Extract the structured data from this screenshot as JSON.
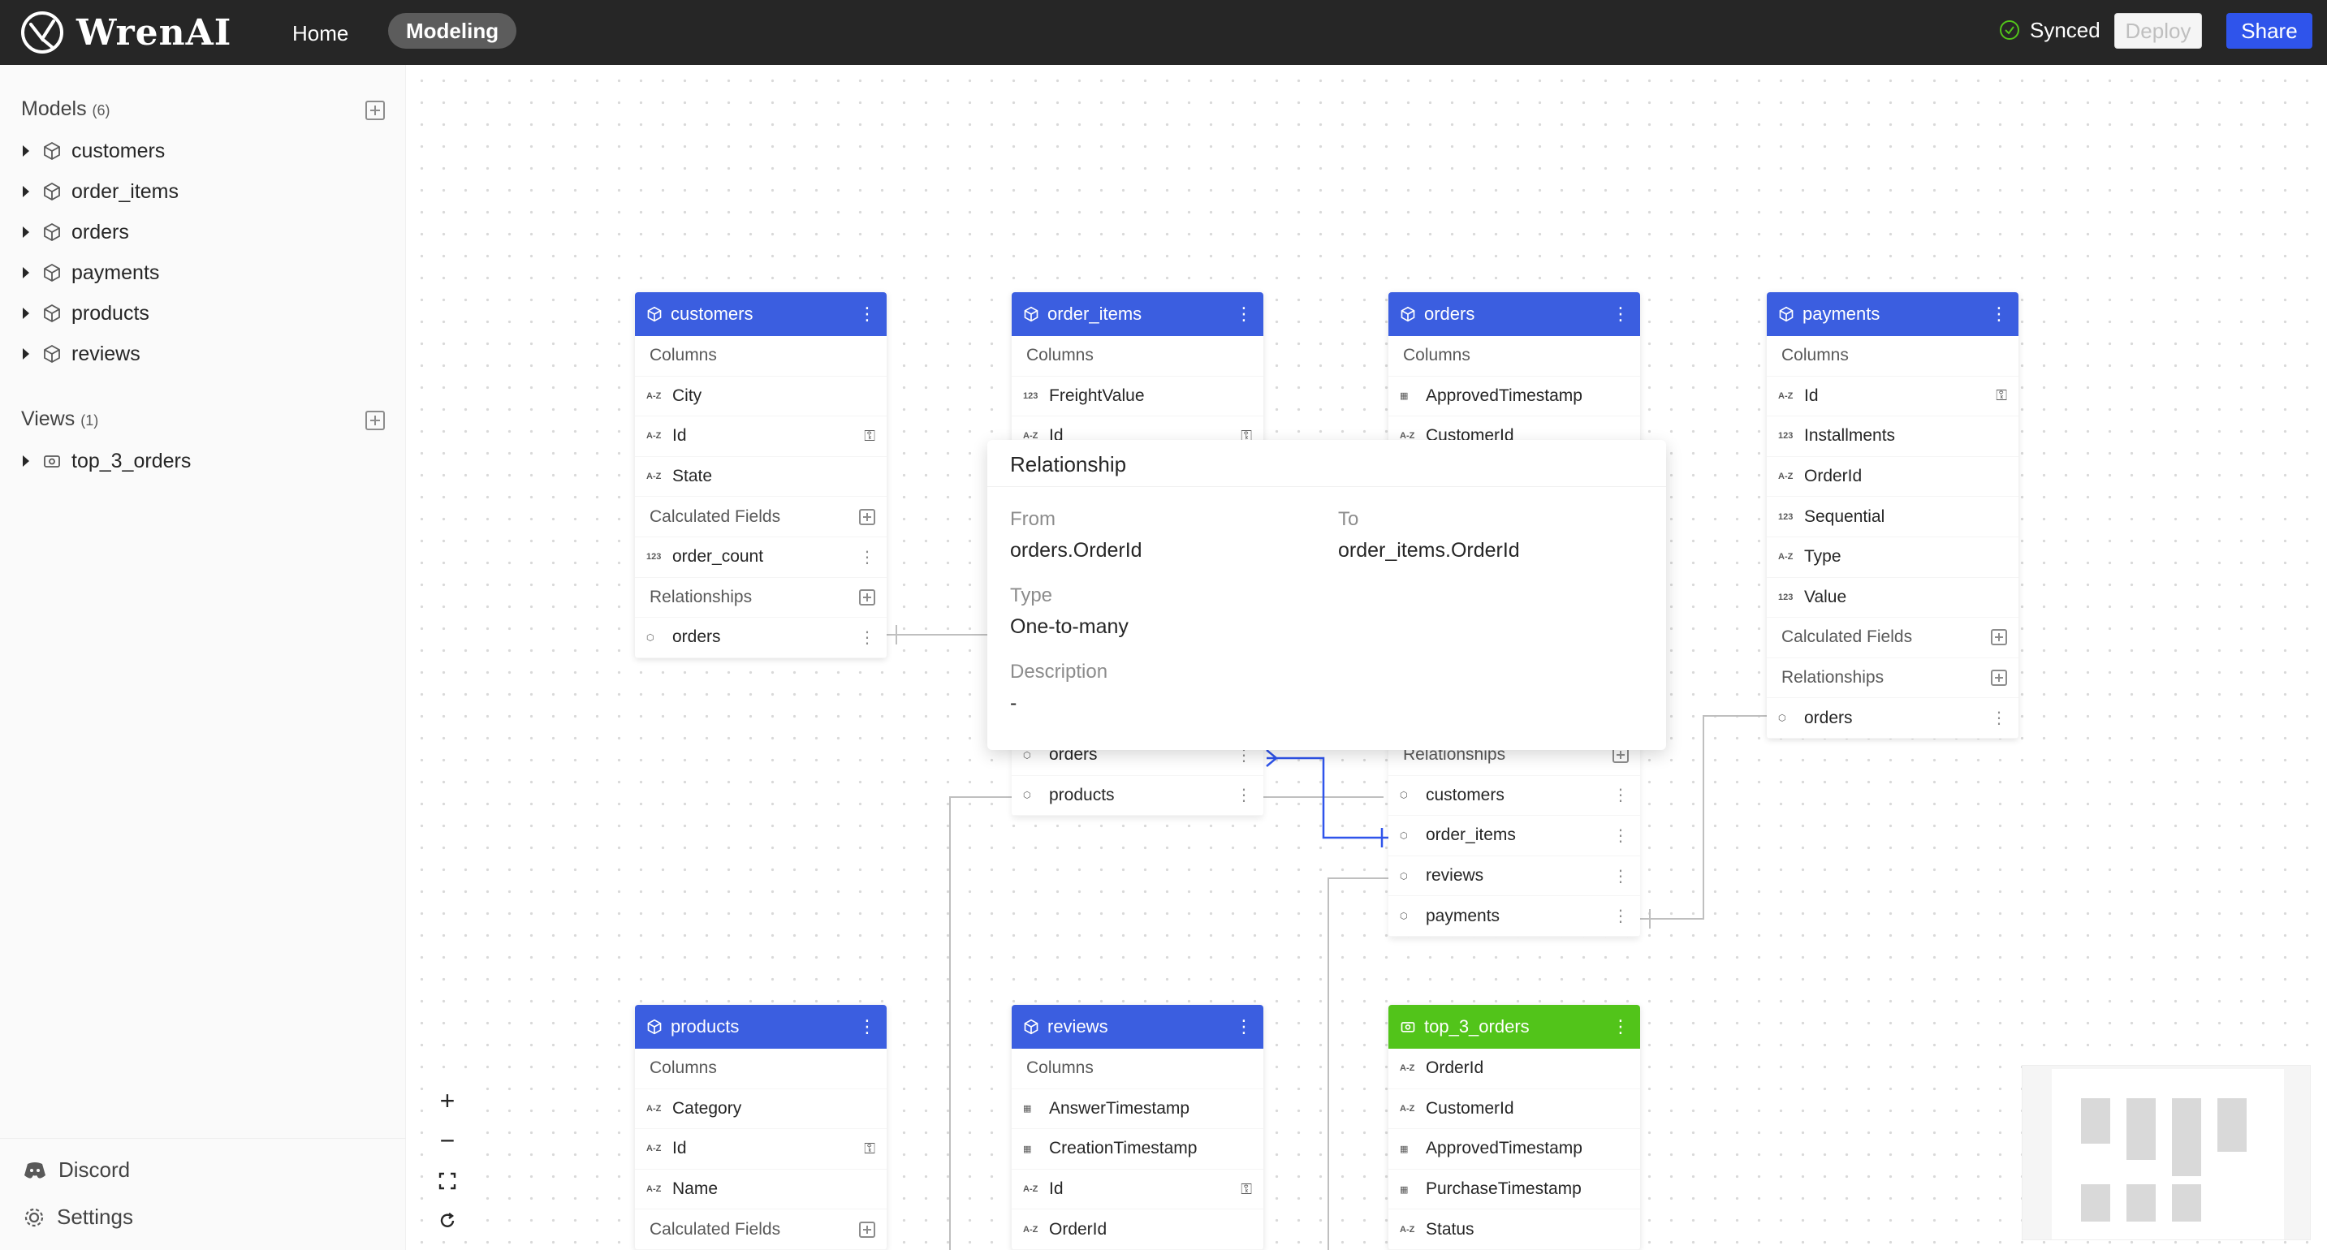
{
  "header": {
    "logo_text": "WrenAI",
    "nav": {
      "home": "Home",
      "modeling": "Modeling"
    },
    "status": "Synced",
    "deploy_label": "Deploy",
    "share_label": "Share"
  },
  "sidebar": {
    "models_title": "Models",
    "models_count": "(6)",
    "models": [
      "customers",
      "order_items",
      "orders",
      "payments",
      "products",
      "reviews"
    ],
    "views_title": "Views",
    "views_count": "(1)",
    "views": [
      "top_3_orders"
    ],
    "discord": "Discord",
    "settings": "Settings"
  },
  "nodes": {
    "customers": {
      "title": "customers",
      "columns_label": "Columns",
      "columns": [
        {
          "type": "A-Z",
          "name": "City"
        },
        {
          "type": "A-Z",
          "name": "Id",
          "key": true
        },
        {
          "type": "A-Z",
          "name": "State"
        }
      ],
      "calc_label": "Calculated Fields",
      "calc": [
        {
          "type": "123",
          "name": "order_count"
        }
      ],
      "rel_label": "Relationships",
      "rels": [
        "orders"
      ]
    },
    "order_items": {
      "title": "order_items",
      "columns_label": "Columns",
      "columns": [
        {
          "type": "123",
          "name": "FreightValue"
        },
        {
          "type": "A-Z",
          "name": "Id"
        }
      ],
      "rels": [
        "orders",
        "products"
      ]
    },
    "orders": {
      "title": "orders",
      "columns_label": "Columns",
      "columns": [
        {
          "type": "cal",
          "name": "ApprovedTimestamp"
        },
        {
          "type": "A-Z",
          "name": "CustomerId"
        }
      ],
      "rel_label": "Relationships",
      "rels": [
        "customers",
        "order_items",
        "reviews",
        "payments"
      ]
    },
    "payments": {
      "title": "payments",
      "columns_label": "Columns",
      "columns": [
        {
          "type": "A-Z",
          "name": "Id",
          "key": true
        },
        {
          "type": "123",
          "name": "Installments"
        },
        {
          "type": "A-Z",
          "name": "OrderId"
        },
        {
          "type": "123",
          "name": "Sequential"
        },
        {
          "type": "A-Z",
          "name": "Type"
        },
        {
          "type": "123",
          "name": "Value"
        }
      ],
      "calc_label": "Calculated Fields",
      "rel_label": "Relationships",
      "rels": [
        "orders"
      ]
    },
    "products": {
      "title": "products",
      "columns_label": "Columns",
      "columns": [
        {
          "type": "A-Z",
          "name": "Category"
        },
        {
          "type": "A-Z",
          "name": "Id",
          "key": true
        },
        {
          "type": "A-Z",
          "name": "Name"
        }
      ],
      "calc_label": "Calculated Fields"
    },
    "reviews": {
      "title": "reviews",
      "columns_label": "Columns",
      "columns": [
        {
          "type": "cal",
          "name": "AnswerTimestamp"
        },
        {
          "type": "cal",
          "name": "CreationTimestamp"
        },
        {
          "type": "A-Z",
          "name": "Id",
          "key": true
        },
        {
          "type": "A-Z",
          "name": "OrderId"
        }
      ]
    },
    "top_3_orders": {
      "title": "top_3_orders",
      "columns": [
        {
          "type": "A-Z",
          "name": "OrderId"
        },
        {
          "type": "A-Z",
          "name": "CustomerId"
        },
        {
          "type": "cal",
          "name": "ApprovedTimestamp"
        },
        {
          "type": "cal",
          "name": "PurchaseTimestamp"
        },
        {
          "type": "A-Z",
          "name": "Status"
        }
      ]
    }
  },
  "popover": {
    "title": "Relationship",
    "from_label": "From",
    "from_value": "orders.OrderId",
    "to_label": "To",
    "to_value": "order_items.OrderId",
    "type_label": "Type",
    "type_value": "One-to-many",
    "desc_label": "Description",
    "desc_value": "-"
  },
  "colors": {
    "topbar": "#262626",
    "model_header": "#3b5ee0",
    "view_header": "#52c41a",
    "share": "#2f54eb",
    "synced": "#52c41a"
  }
}
